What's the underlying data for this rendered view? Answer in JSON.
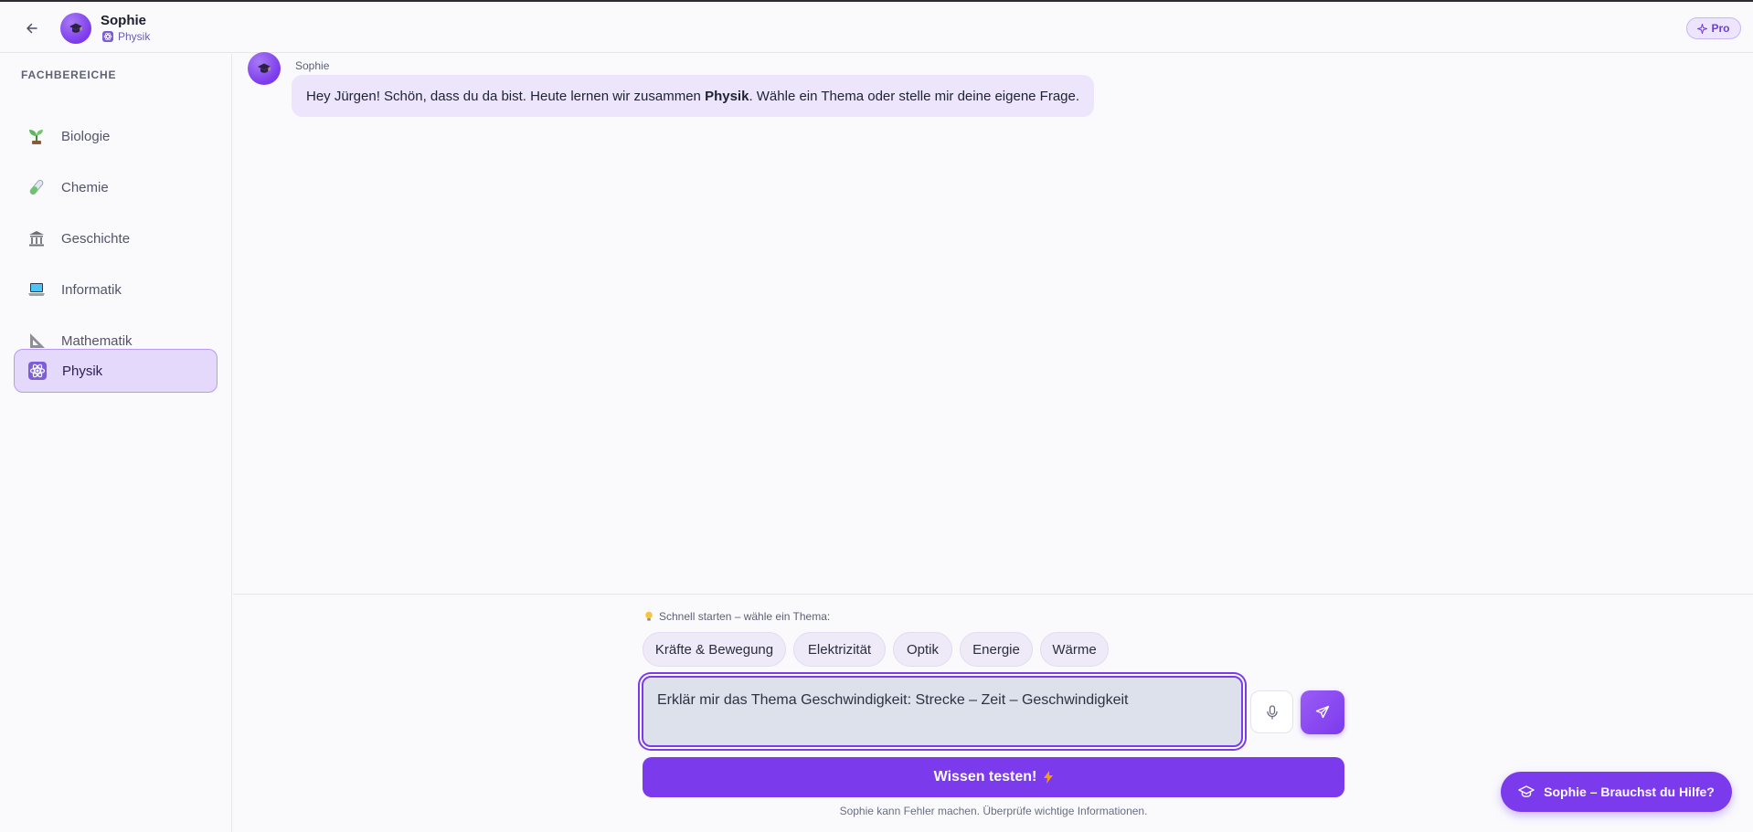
{
  "header": {
    "name": "Sophie",
    "subject": "Physik",
    "pro_label": "Pro"
  },
  "sidebar": {
    "heading": "FACHBEREICHE",
    "items": [
      {
        "label": "Biologie",
        "icon": "seedling-icon"
      },
      {
        "label": "Chemie",
        "icon": "test-tube-icon"
      },
      {
        "label": "Geschichte",
        "icon": "classical-building-icon"
      },
      {
        "label": "Informatik",
        "icon": "laptop-icon"
      },
      {
        "label": "Mathematik",
        "icon": "triangle-ruler-icon"
      },
      {
        "label": "Physik",
        "icon": "atom-icon",
        "active": true
      }
    ]
  },
  "chat": {
    "author": "Sophie",
    "message_before": "Hey Jürgen! Schön, dass du da bist. Heute lernen wir zusammen ",
    "message_bold": "Physik",
    "message_after": ". Wähle ein Thema oder stelle mir deine eigene Frage."
  },
  "composer": {
    "quick_label": "Schnell starten – wähle ein Thema:",
    "chips": [
      "Kräfte & Bewegung",
      "Elektrizität",
      "Optik",
      "Energie",
      "Wärme"
    ],
    "input_value": "Erklär mir das Thema Geschwindigkeit: Strecke – Zeit – Geschwindigkeit",
    "test_button": "Wissen testen!",
    "disclaimer": "Sophie kann Fehler machen. Überprüfe wichtige Informationen."
  },
  "help_button": "Sophie – Brauchst du Hilfe?",
  "colors": {
    "accent": "#7c3aed",
    "accent_light": "#e4d8fb",
    "bubble": "#ece5fb"
  }
}
